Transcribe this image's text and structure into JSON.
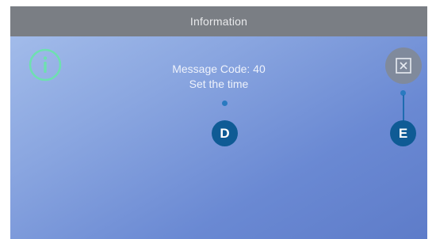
{
  "dialog": {
    "title": "Information",
    "message_code": "Message Code: 40",
    "message_text": "Set the time",
    "info_icon": "info-circle-icon",
    "close_icon": "close-box-icon"
  },
  "callouts": {
    "d": "D",
    "e": "E"
  },
  "colors": {
    "title_bar": "#7a7e84",
    "info_ring": "#6ee0b0",
    "close_button": "#808a9c",
    "callout_badge": "#0f5b95"
  }
}
